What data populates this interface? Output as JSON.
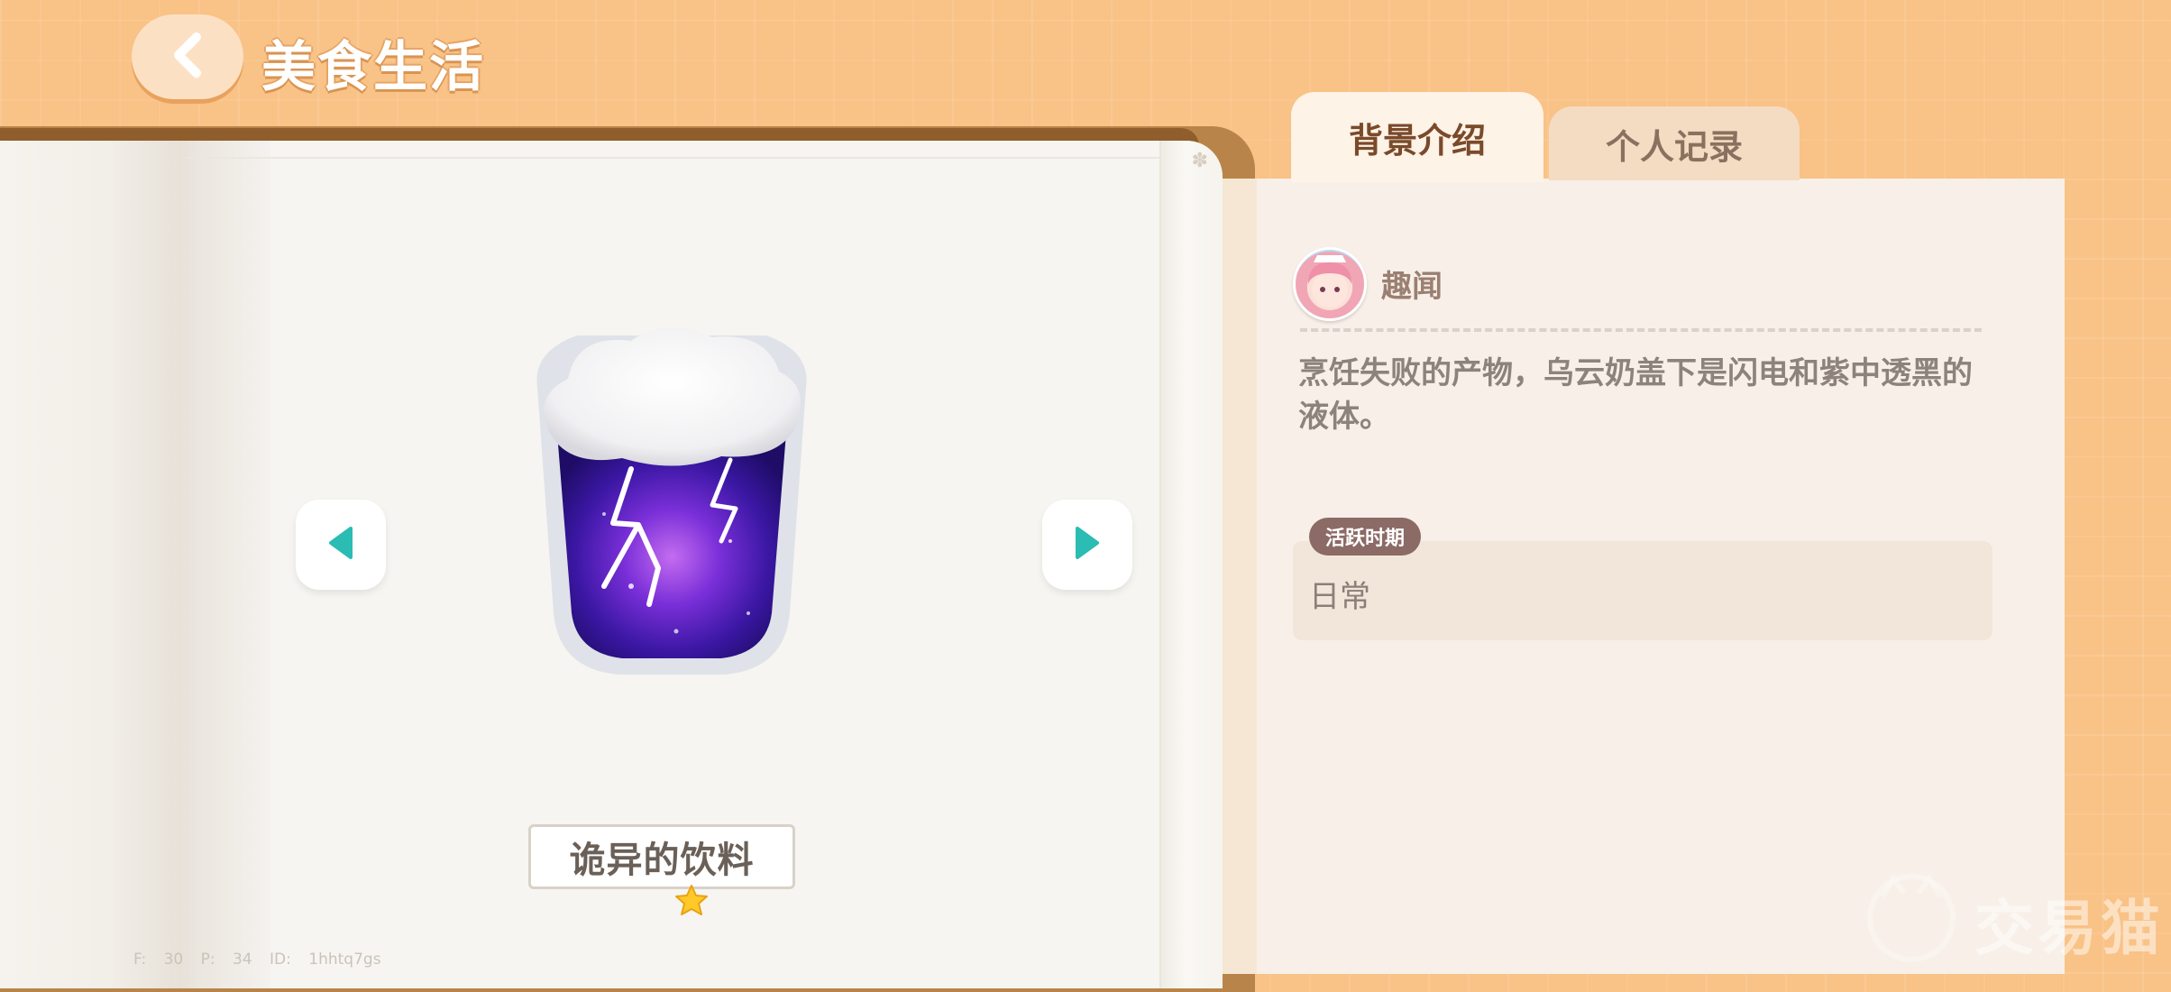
{
  "header": {
    "back_icon": "chevron-left-icon",
    "title": "美食生活"
  },
  "book": {
    "item_name": "诡异的饮料",
    "item_icon": "storm-cloud-drink-icon",
    "rarity_icon": "star-icon",
    "prev_icon": "triangle-left-icon",
    "next_icon": "triangle-right-icon",
    "debug_info": "F: 30 P: 34 ID: 1hhtq7gs"
  },
  "tabs": [
    {
      "label": "背景介绍",
      "active": true
    },
    {
      "label": "个人记录",
      "active": false
    }
  ],
  "panel": {
    "section_title": "趣闻",
    "description": "烹饪失败的产物，乌云奶盖下是闪电和紫中透黑的液体。",
    "active_period": {
      "badge": "活跃时期",
      "value": "日常"
    }
  },
  "watermark": {
    "text": "交易猫"
  },
  "colors": {
    "background": "#f9c286",
    "accent_teal": "#2bbcb4",
    "tab_active": "#fdf3e7",
    "badge": "#8c6a66"
  }
}
